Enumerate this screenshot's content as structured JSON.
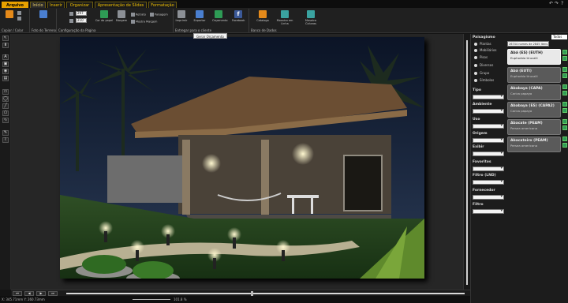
{
  "tabs": [
    {
      "label": "Arquivo"
    },
    {
      "label": "Início"
    },
    {
      "label": "Inserir"
    },
    {
      "label": "Organizar"
    },
    {
      "label": "Apresentação de Slides"
    },
    {
      "label": "Formatação"
    }
  ],
  "ribbon": {
    "groups": [
      {
        "label": "Copiar / Colar"
      },
      {
        "label": "Foto do Terreno"
      },
      {
        "label": "Configuração da Página"
      },
      {
        "label": "Entregar para o cliente"
      },
      {
        "label": "Banco de Dados"
      }
    ],
    "page_width": "297",
    "page_height": "210",
    "cor_do_papel": "Cor do papel",
    "margem": "Margem",
    "retrato": "Retrato",
    "paisagem": "Paisagem",
    "mostra_margem": "Mostra Margem",
    "imprimir": "Imprimir",
    "exportar": "Exportar",
    "orcamento": "Orçamento",
    "facebook": "Facebook",
    "catalogo": "Catalogo",
    "mosaico_linha": "Mosaico em Linha",
    "mosaico_colunas": "Mosaico Colunas",
    "tooltip": "Gerar Orçamento"
  },
  "right_panel": {
    "tools_label": "Todos",
    "search_value": "26744 nomes de 2845 itens ...",
    "palette_title": "Paisagismo",
    "categories": [
      "Plantas",
      "Mobiliários",
      "Pisos",
      "Diversos",
      "Grupo",
      "Símbolos"
    ],
    "filters": [
      {
        "label": "Tipo"
      },
      {
        "label": "Ambiente"
      },
      {
        "label": "Uso"
      },
      {
        "label": "Origem"
      },
      {
        "label": "Exibir"
      },
      {
        "label": "Favoritos"
      },
      {
        "label": "Filtro (LND)"
      },
      {
        "label": "Fornecedor"
      },
      {
        "label": "Filtro"
      }
    ],
    "items": [
      {
        "name": "Abá (ES) (EUTH)",
        "sci": "Euphorbia tirucalli"
      },
      {
        "name": "Abá (EUTI)",
        "sci": "Euphorbia tirucalli"
      },
      {
        "name": "Ababaya (CAPA)",
        "sci": "Carica papaya"
      },
      {
        "name": "Ababaya (ES) (CAPA2)",
        "sci": "Carica papaya"
      },
      {
        "name": "Abacate (PEAM)",
        "sci": "Persea americana"
      },
      {
        "name": "Abacateiro (PEAM)",
        "sci": "Persea americana"
      }
    ]
  },
  "status": {
    "coords": "X: 345.71mm  Y: 260.73mm",
    "zoom": "101.8 %"
  },
  "colors": {
    "accent": "#f2c200",
    "file_tab": "#e8a100"
  }
}
